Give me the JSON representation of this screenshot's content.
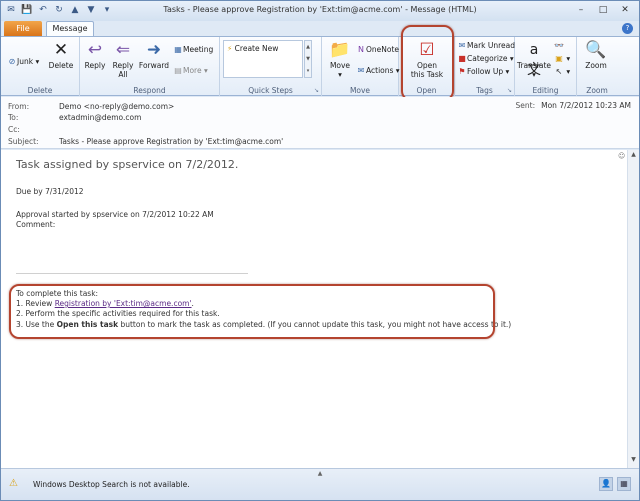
{
  "window": {
    "title": "Tasks - Please approve Registration by 'Ext:tim@acme.com' - Message (HTML)",
    "min": "–",
    "max": "□",
    "close": "✕"
  },
  "tabs": {
    "file": "File",
    "message": "Message",
    "help": "?"
  },
  "ribbon": {
    "delete_group": {
      "label": "Delete",
      "junk": "Junk",
      "delete": "Delete"
    },
    "respond_group": {
      "label": "Respond",
      "reply": "Reply",
      "reply_all_1": "Reply",
      "reply_all_2": "All",
      "forward": "Forward",
      "meeting": "Meeting",
      "more": "More"
    },
    "quick_steps": {
      "label": "Quick Steps",
      "create_new": "Create New"
    },
    "move_group": {
      "label": "Move",
      "move": "Move",
      "onenote": "OneNote",
      "actions": "Actions"
    },
    "open_group": {
      "label": "Open",
      "open_task_1": "Open",
      "open_task_2": "this Task"
    },
    "tags_group": {
      "label": "Tags",
      "mark_unread": "Mark Unread",
      "categorize": "Categorize",
      "follow_up": "Follow Up"
    },
    "editing_group": {
      "label": "Editing",
      "translate": "Translate"
    },
    "zoom_group": {
      "label": "Zoom",
      "zoom": "Zoom"
    }
  },
  "header": {
    "from_label": "From:",
    "from_value": "Demo <no-reply@demo.com>",
    "to_label": "To:",
    "to_value": "extadmin@demo.com",
    "cc_label": "Cc:",
    "subject_label": "Subject:",
    "subject_value": "Tasks - Please approve Registration by 'Ext:tim@acme.com'",
    "sent_label": "Sent:",
    "sent_value": "Mon 7/2/2012 10:23 AM"
  },
  "body": {
    "title": "Task assigned by spservice on 7/2/2012.",
    "due": "Due by 7/31/2012",
    "approval": "Approval started by spservice on 7/2/2012 10:22 AM",
    "comment": "Comment:",
    "instructions_heading": "To complete this task:",
    "step1_prefix": "1. Review ",
    "step1_link": "Registration by 'Ext:tim@acme.com'",
    "step1_suffix": ".",
    "step2": "2. Perform the specific activities required for this task.",
    "step3_prefix": "3. Use the ",
    "step3_bold": "Open this task",
    "step3_suffix": " button to mark the task as completed. (If you cannot update this task, you might not have access to it.)"
  },
  "status": {
    "text": "Windows Desktop Search is not available."
  },
  "colors": {
    "highlight": "#b4442f",
    "file_tab": "#d9741a",
    "link": "#5b2a86"
  }
}
